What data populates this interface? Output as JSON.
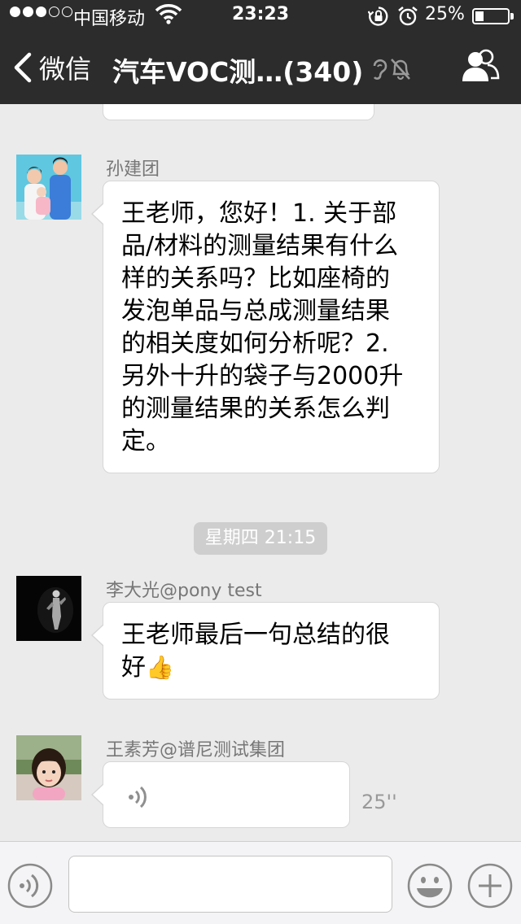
{
  "status_bar": {
    "signal_dots": "●●●○○",
    "carrier": "中国移动",
    "time": "23:23",
    "battery_text": "25%",
    "battery_level": 0.25,
    "icons": [
      "signal-dots-icon",
      "wifi-icon",
      "orientation-lock-icon",
      "alarm-clock-icon",
      "battery-icon"
    ]
  },
  "nav": {
    "back_label": "微信",
    "title": "汽车VOC测…(340)",
    "icons": [
      "back-chevron-icon",
      "earpiece-icon",
      "mute-bell-icon",
      "group-members-icon"
    ]
  },
  "messages": [
    {
      "sender": "孙建团",
      "avatar": "family-photo-avatar",
      "text": [
        "王老师，您好！1. 关于部",
        "品/材料的测量结果有什么",
        "样的关系吗？比如座椅的",
        "发泡单品与总成测量结果",
        "的相关度如何分析呢？2.",
        "另外十升的袋子与2000升",
        "的测量结果的关系怎么判",
        "定。"
      ]
    },
    {
      "timestamp": "星期四 21:15"
    },
    {
      "sender": "李大光@pony test",
      "avatar": "dark-stage-avatar",
      "text": [
        "王老师最后一句总结的很",
        "好"
      ],
      "emoji": "👍",
      "emoji_icon": "thumbs-up-icon"
    },
    {
      "sender": "王素芳@谱尼测试集团",
      "avatar": "child-photo-avatar",
      "voice_duration": "25''",
      "voice_icon": "voice-wave-icon"
    }
  ],
  "input_bar": {
    "value": "",
    "icons": [
      "voice-input-icon",
      "emoji-face-icon",
      "plus-icon"
    ]
  },
  "colors": {
    "nav_background": "#2c2c2c",
    "chat_background": "#ebebeb",
    "bubble": "#ffffff",
    "timestamp_pill": "#cecece",
    "input_bar": "#f4f4f6"
  }
}
